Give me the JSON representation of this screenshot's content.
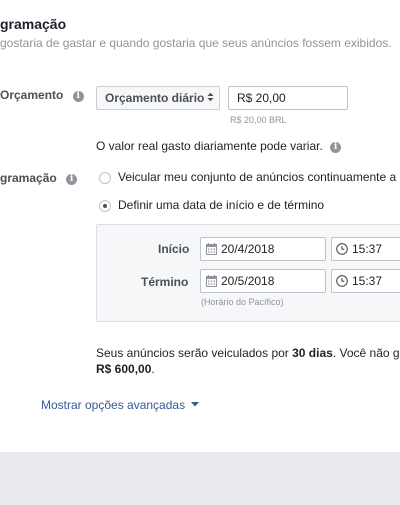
{
  "header": {
    "title": "gramação",
    "subtitle": "gostaria de gastar e quando gostaria que seus anúncios fossem exibidos."
  },
  "budget": {
    "label": "Orçamento",
    "type_select_value": "Orçamento diário",
    "amount_value": "R$ 20,00",
    "amount_hint": "R$ 20,00 BRL",
    "note": "O valor real gasto diariamente pode variar."
  },
  "schedule": {
    "label": "gramação",
    "options": [
      {
        "label": "Veicular meu conjunto de anúncios continuamente a",
        "selected": false
      },
      {
        "label": "Definir uma data de início e de término",
        "selected": true
      }
    ],
    "start": {
      "label": "Início",
      "date": "20/4/2018",
      "time": "15:37"
    },
    "end": {
      "label": "Término",
      "date": "20/5/2018",
      "time": "15:37"
    },
    "timezone_note": "(Horário do Pacífico)"
  },
  "summary": {
    "line1_prefix": "Seus anúncios serão veiculados por ",
    "line1_days": "30 dias",
    "line1_suffix": ". Você não g",
    "line2_amount": "R$ 600,00",
    "line2_suffix": "."
  },
  "advanced_link": {
    "label": "Mostrar opções avançadas",
    "icon": "caret-down-icon"
  },
  "colors": {
    "link": "#365899",
    "panel_bg": "#f6f7f9",
    "footer_bg": "#e9ebee",
    "muted_text": "#90949c"
  }
}
